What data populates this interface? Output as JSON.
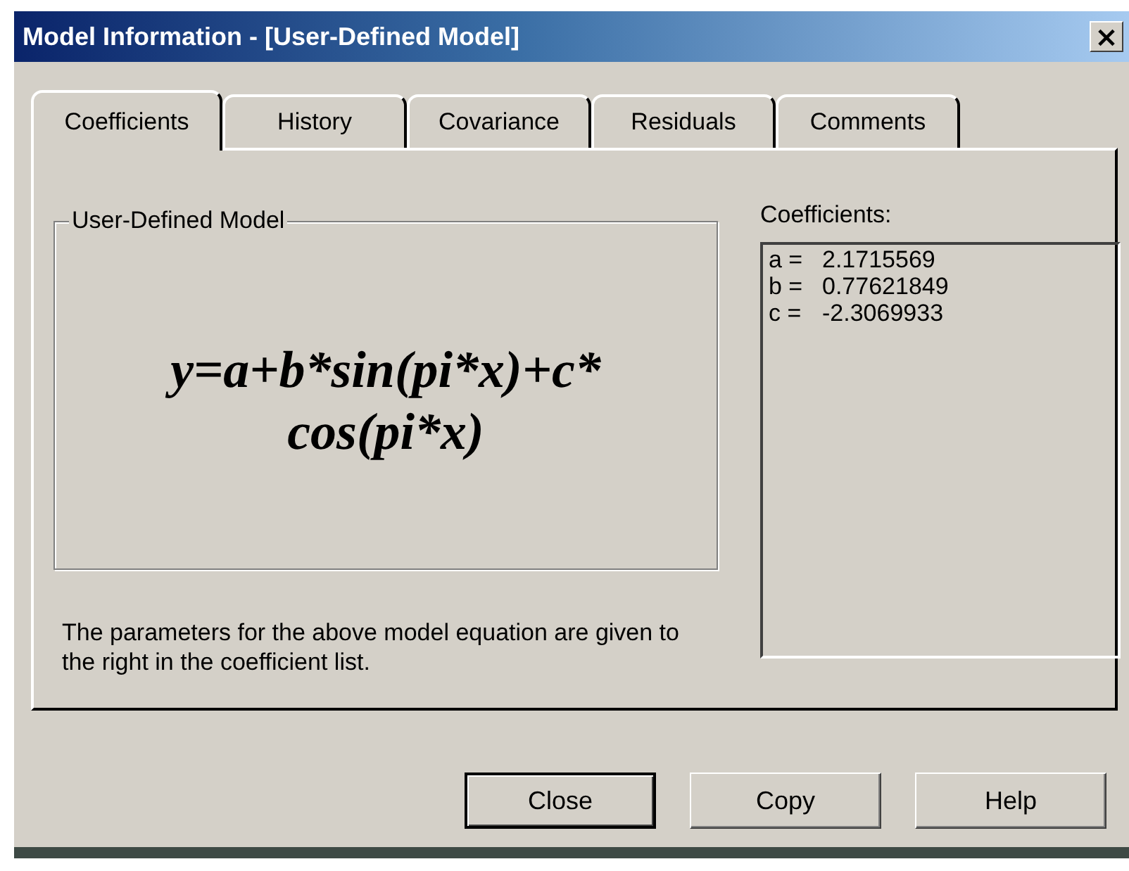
{
  "window": {
    "title": "Model Information - [User-Defined Model]",
    "close": "×"
  },
  "tabs": [
    {
      "label": "Coefficients",
      "selected": true
    },
    {
      "label": "History",
      "selected": false
    },
    {
      "label": "Covariance",
      "selected": false
    },
    {
      "label": "Residuals",
      "selected": false
    },
    {
      "label": "Comments",
      "selected": false
    }
  ],
  "model_group": {
    "title": "User-Defined Model",
    "equation": "y=a+b*sin(pi*x)+c* cos(pi*x)"
  },
  "description": "The parameters for the above model equation are given to the right in the coefficient list.",
  "coefficients": {
    "label": "Coefficients:",
    "items": [
      {
        "name": "a =",
        "value": "2.1715569"
      },
      {
        "name": "b =",
        "value": "0.77621849"
      },
      {
        "name": "c =",
        "value": "-2.3069933"
      }
    ]
  },
  "buttons": [
    {
      "label": "Close",
      "default": true
    },
    {
      "label": "Copy",
      "default": false
    },
    {
      "label": "Help",
      "default": false
    }
  ]
}
